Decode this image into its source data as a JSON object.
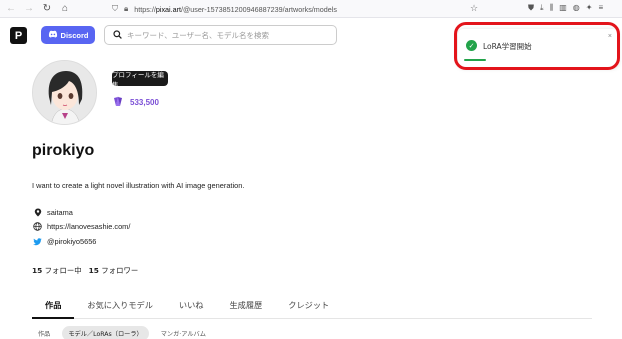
{
  "browser": {
    "url_prefix": "https://",
    "url_host": "pixai.art",
    "url_path": "/@user-1573851200946887239/artworks/models"
  },
  "header": {
    "logo_text": "P",
    "discord_label": "Discord",
    "search_placeholder": "キーワード、ユーザー名、モデル名を検索"
  },
  "profile": {
    "edit_button": "プロフィールを編集",
    "points": "533,500",
    "username": "pirokiyo",
    "bio": "I want to create a light novel illustration with AI image generation.",
    "location": "saitama",
    "website": "https://lanovesashie.com/",
    "twitter": "@pirokiyo5656",
    "following_count": "15",
    "following_label": "フォロー中",
    "followers_count": "15",
    "followers_label": "フォロワー"
  },
  "tabs": [
    "作品",
    "お気に入りモデル",
    "いいね",
    "生成履歴",
    "クレジット"
  ],
  "subtabs": [
    "作品",
    "モデル／LoRAs（ローラ）",
    "マンガ·アルバム"
  ],
  "toast": {
    "message": "LoRA学習開始",
    "close": "×",
    "progress": 0.15
  },
  "colors": {
    "discord": "#5865f2",
    "points": "#7b4fd6",
    "success": "#22a34a",
    "annotation": "#e3141b"
  }
}
